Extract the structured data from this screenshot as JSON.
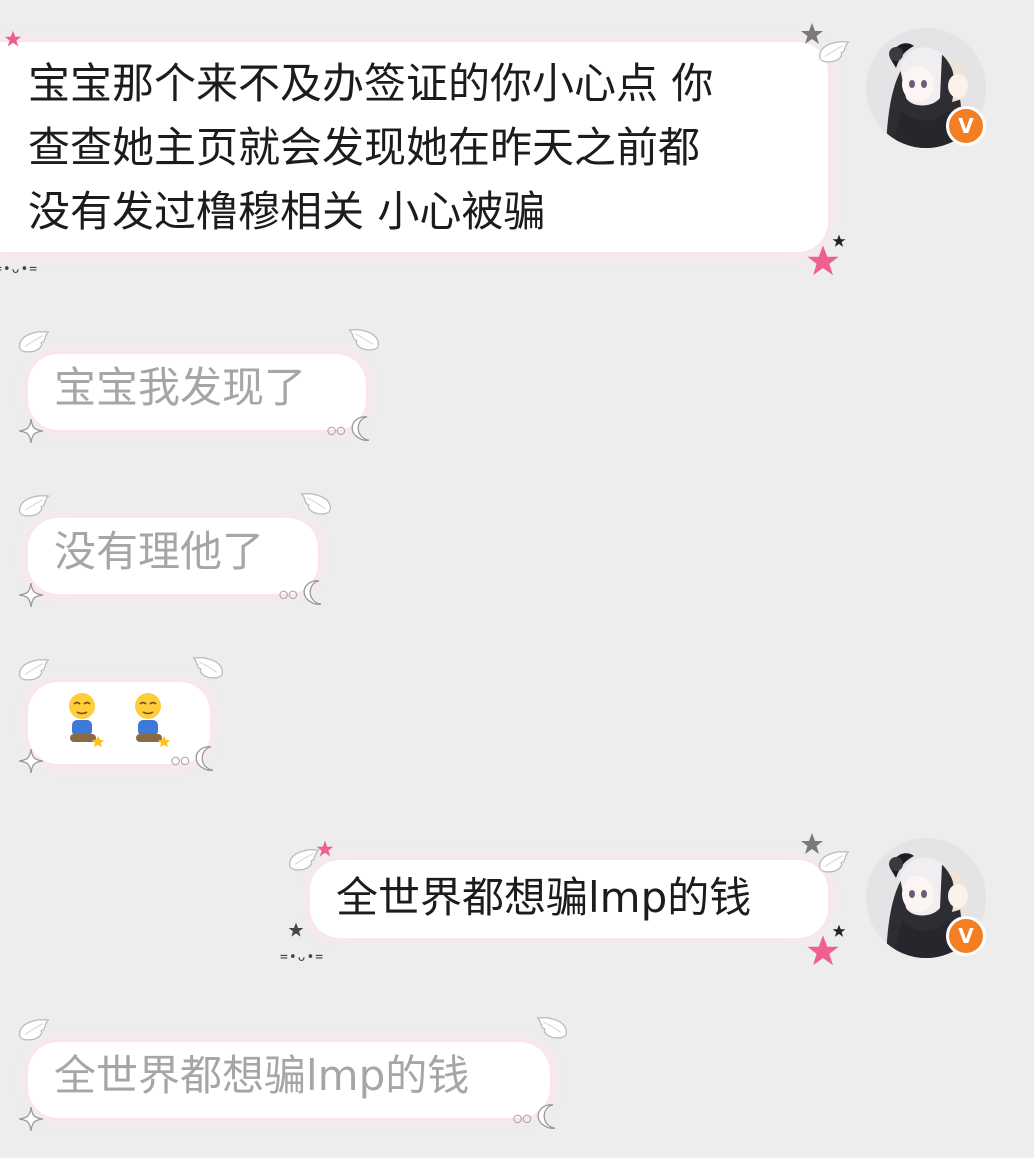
{
  "messages": [
    {
      "direction": "outgoing",
      "text": "宝宝那个来不及办签证的你小心点 你",
      "text2": "查查她主页就会发现她在昨天之前都",
      "text3": "没有发过橹穆相关 小心被骗"
    },
    {
      "direction": "incoming",
      "text": "宝宝我发现了"
    },
    {
      "direction": "incoming",
      "text": "没有理他了"
    },
    {
      "direction": "incoming",
      "content": "emoji",
      "emoji_name": "kneeling-person-emoji"
    },
    {
      "direction": "outgoing",
      "text": "全世界都想骗lmp的钱"
    },
    {
      "direction": "incoming",
      "text": "全世界都想骗lmp的钱"
    }
  ],
  "kaomoji": "=•ᴗ•=",
  "avatar_badge": "V",
  "colors": {
    "background": "#ededed",
    "bubble": "#ffffff",
    "glow": "#fde7ee",
    "badge": "#f37f22",
    "incoming_text": "#a6a6a6"
  }
}
